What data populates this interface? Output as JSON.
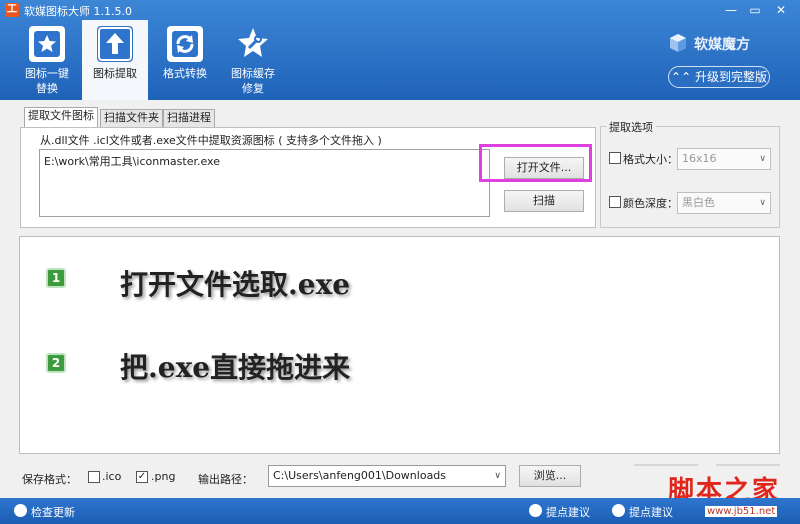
{
  "window": {
    "title": "软媒图标大师 1.1.5.0",
    "logo_char": "工"
  },
  "toolbar": {
    "items": [
      {
        "label": "图标一键替换",
        "label_line1": "图标一键",
        "label_line2": "替换",
        "icon": "star-icon",
        "active": false
      },
      {
        "label": "图标提取",
        "icon": "upload-arrow-icon",
        "active": true
      },
      {
        "label": "格式转换",
        "icon": "refresh-icon",
        "active": false
      },
      {
        "label": "图标缓存修复",
        "label_line1": "图标缓存",
        "label_line2": "修复",
        "icon": "wrench-icon",
        "active": false
      }
    ]
  },
  "brand": {
    "name": "软媒魔方",
    "upgrade_label": "升级到完整版"
  },
  "tabs": [
    {
      "label": "提取文件图标",
      "active": true
    },
    {
      "label": "扫描文件夹",
      "active": false
    },
    {
      "label": "扫描进程",
      "active": false
    }
  ],
  "extract": {
    "hint": "从.dll文件 .icl文件或者.exe文件中提取资源图标 ( 支持多个文件拖入 )",
    "file_path": "E:\\work\\常用工具\\iconmaster.exe",
    "open_label": "打开文件...",
    "scan_label": "扫描"
  },
  "options": {
    "title": "提取选项",
    "format_size_label": "格式大小：",
    "format_size_value": "16x16",
    "color_depth_label": "颜色深度：",
    "color_depth_value": "黑白色"
  },
  "preview": {
    "steps": [
      {
        "number": "1",
        "text": "打开文件选取.exe"
      },
      {
        "number": "2",
        "text": "把.exe直接拖进来"
      }
    ]
  },
  "save": {
    "format_label": "保存格式：",
    "ico_label": ".ico",
    "ico_checked": false,
    "png_label": ".png",
    "png_checked": true,
    "output_label": "输出路径：",
    "output_path": "C:\\Users\\anfeng001\\Downloads",
    "browse_label": "浏览..."
  },
  "statusbar": {
    "check_update": "检查更新",
    "suggest1": "提点建议",
    "suggest2": "提点建议"
  },
  "watermark": {
    "text": "脚本之家",
    "url": "www.jb51.net"
  },
  "colors": {
    "header": "#2b6fc3",
    "highlight": "#e040e0",
    "step_badge": "#3c9b3c",
    "watermark": "#e0261b"
  }
}
